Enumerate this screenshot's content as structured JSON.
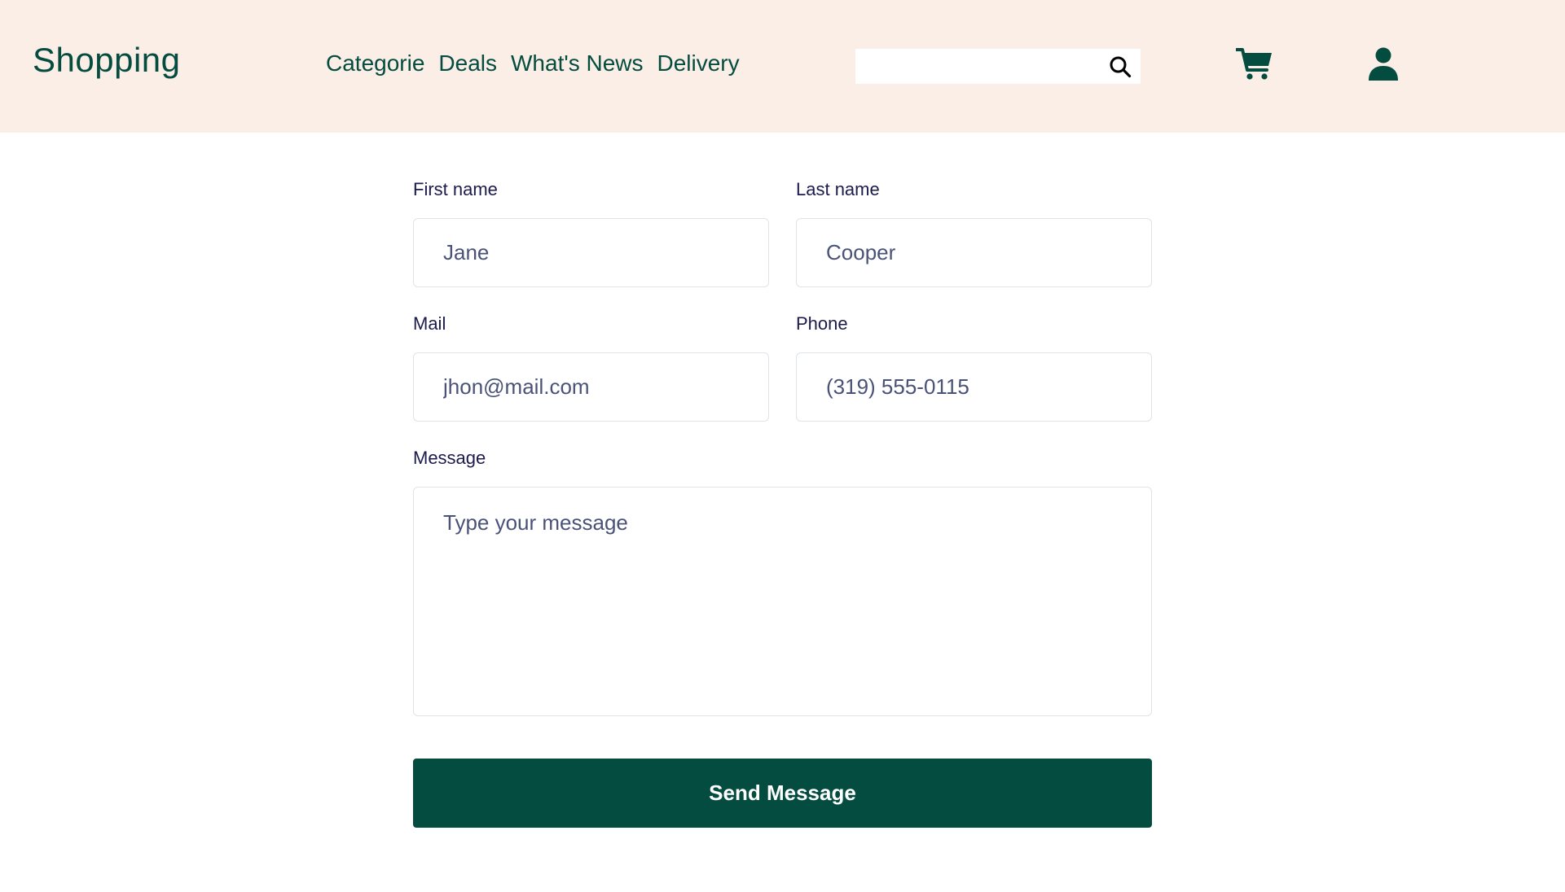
{
  "header": {
    "logo": "Shopping",
    "nav": [
      "Categorie",
      "Deals",
      "What's News",
      "Delivery"
    ],
    "search": {
      "value": "",
      "placeholder": ""
    },
    "icons": {
      "search": "search-icon",
      "cart": "cart-icon",
      "user": "user-icon"
    }
  },
  "form": {
    "first_name": {
      "label": "First name",
      "value": "Jane"
    },
    "last_name": {
      "label": "Last name",
      "value": "Cooper"
    },
    "mail": {
      "label": "Mail",
      "value": "jhon@mail.com"
    },
    "phone": {
      "label": "Phone",
      "value": "(319) 555-0115"
    },
    "message": {
      "label": "Message",
      "placeholder": "Type your message"
    },
    "submit_label": "Send Message"
  },
  "colors": {
    "brand": "#034c3f",
    "header_bg": "#fbeee6",
    "text": "#1b1b4d",
    "input_text": "#4a5277",
    "border": "#dfe3ea"
  }
}
